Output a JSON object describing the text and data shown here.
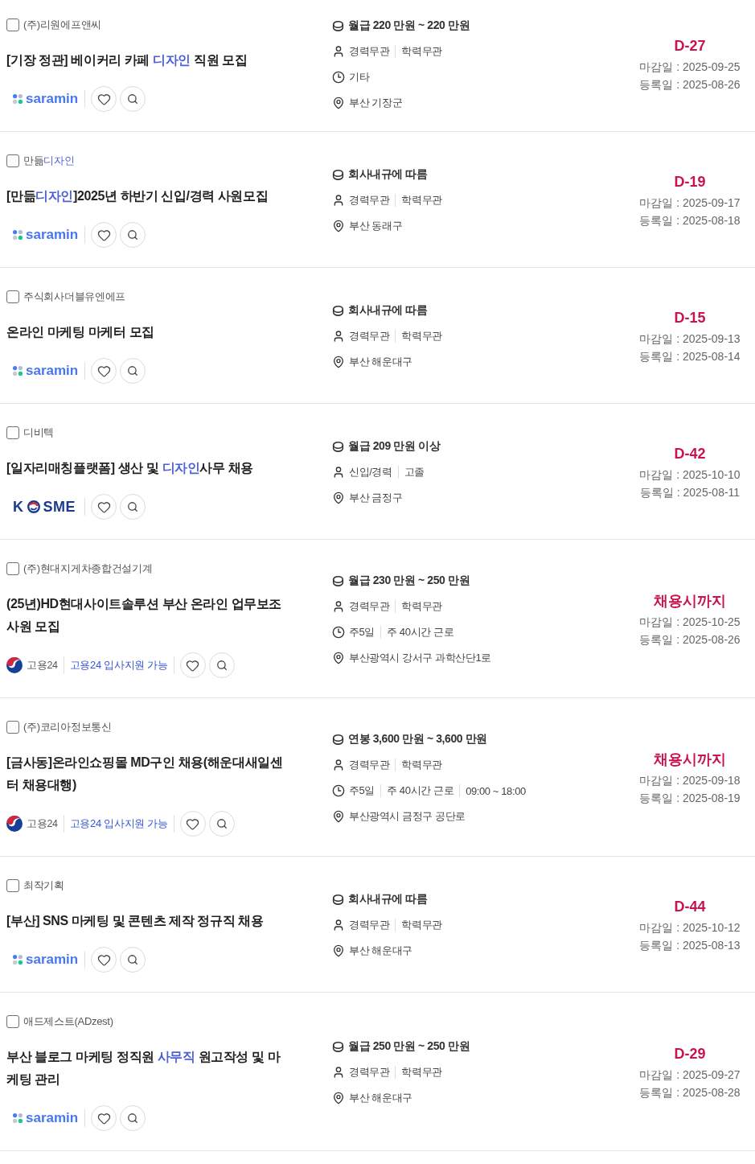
{
  "jobs": [
    {
      "checked": false,
      "company": [
        {
          "text": "(주)리원에프앤씨",
          "highlight": false
        }
      ],
      "title": [
        {
          "text": "[기장 정관] 베이커리 카페 ",
          "highlight": false
        },
        {
          "text": "디자인",
          "highlight": true
        },
        {
          "text": " 직원 모집",
          "highlight": false
        }
      ],
      "source": {
        "kind": "dots",
        "wordmark": [
          "saramin"
        ]
      },
      "saved": false,
      "details": [
        {
          "kind": "salary",
          "values": [
            "월급 220 만원 ~ 220 만원"
          ]
        },
        {
          "kind": "career",
          "values": [
            "경력무관",
            "학력무관"
          ]
        },
        {
          "kind": "time",
          "values": [
            "기타"
          ]
        },
        {
          "kind": "location",
          "values": [
            "부산 기장군"
          ]
        }
      ],
      "deadline": "D-27",
      "deadline_date": "마감일 : 2025-09-25",
      "posted_date": "등록일 : 2025-08-26"
    },
    {
      "checked": false,
      "company": [
        {
          "text": "만듦",
          "highlight": false
        },
        {
          "text": "디자인",
          "highlight": true
        }
      ],
      "title": [
        {
          "text": "[만듦",
          "highlight": false
        },
        {
          "text": "디자인",
          "highlight": true
        },
        {
          "text": "]2025년 하반기 신입/경력 사원모집",
          "highlight": false
        }
      ],
      "source": {
        "kind": "dots",
        "wordmark": [
          "saramin"
        ]
      },
      "saved": false,
      "details": [
        {
          "kind": "salary",
          "values": [
            "회사내규에 따름"
          ]
        },
        {
          "kind": "career",
          "values": [
            "경력무관",
            "학력무관"
          ]
        },
        {
          "kind": "location",
          "values": [
            "부산 동래구"
          ]
        }
      ],
      "deadline": "D-19",
      "deadline_date": "마감일 : 2025-09-17",
      "posted_date": "등록일 : 2025-08-18"
    },
    {
      "checked": false,
      "company": [
        {
          "text": "주식회사더블유엔에프",
          "highlight": false
        }
      ],
      "title": [
        {
          "text": "온라인 마케팅 마케터 모집",
          "highlight": false
        }
      ],
      "source": {
        "kind": "dots",
        "wordmark": [
          "saramin"
        ]
      },
      "saved": false,
      "details": [
        {
          "kind": "salary",
          "values": [
            "회사내규에 따름"
          ]
        },
        {
          "kind": "career",
          "values": [
            "경력무관",
            "학력무관"
          ]
        },
        {
          "kind": "location",
          "values": [
            "부산 해운대구"
          ]
        }
      ],
      "deadline": "D-15",
      "deadline_date": "마감일 : 2025-09-13",
      "posted_date": "등록일 : 2025-08-14"
    },
    {
      "checked": false,
      "company": [
        {
          "text": "디비텍",
          "highlight": false
        }
      ],
      "title": [
        {
          "text": "[일자리매칭플랫폼] 생산 및 ",
          "highlight": false
        },
        {
          "text": "디자인",
          "highlight": true
        },
        {
          "text": "사무 채용",
          "highlight": false
        }
      ],
      "source": {
        "kind": "swirl",
        "wordmark": [
          "K",
          "SME"
        ]
      },
      "saved": false,
      "details": [
        {
          "kind": "salary",
          "values": [
            "월급 209 만원 이상"
          ]
        },
        {
          "kind": "career",
          "values": [
            "신입/경력",
            "고졸"
          ]
        },
        {
          "kind": "location",
          "values": [
            "부산 금정구"
          ]
        }
      ],
      "deadline": "D-42",
      "deadline_date": "마감일 : 2025-10-10",
      "posted_date": "등록일 : 2025-08-11"
    },
    {
      "checked": false,
      "company": [
        {
          "text": "(주)현대지게차종합건설기계",
          "highlight": false
        }
      ],
      "title": [
        {
          "text": "(25년)HD현대사이트솔루션 부산 온라인 업무보조 사원 모집",
          "highlight": false
        }
      ],
      "source": {
        "kind": "emblem",
        "wordmark": [
          "고용24"
        ],
        "apply_link": "고용24 입사지원 가능"
      },
      "saved": false,
      "details": [
        {
          "kind": "salary",
          "values": [
            "월급 230 만원 ~ 250 만원"
          ]
        },
        {
          "kind": "career",
          "values": [
            "경력무관",
            "학력무관"
          ]
        },
        {
          "kind": "time",
          "values": [
            "주5일",
            "주 40시간 근로"
          ]
        },
        {
          "kind": "location",
          "values": [
            "부산광역시 강서구 과학산단1로"
          ]
        }
      ],
      "deadline": "채용시까지",
      "deadline_date": "마감일 : 2025-10-25",
      "posted_date": "등록일 : 2025-08-26"
    },
    {
      "checked": false,
      "company": [
        {
          "text": "(주)코리아정보통신",
          "highlight": false
        }
      ],
      "title": [
        {
          "text": "[금사동]온라인쇼핑몰 MD구인 채용(해운대새일센터 채용대행)",
          "highlight": false
        }
      ],
      "source": {
        "kind": "emblem",
        "wordmark": [
          "고용24"
        ],
        "apply_link": "고용24 입사지원 가능"
      },
      "saved": false,
      "details": [
        {
          "kind": "salary",
          "values": [
            "연봉 3,600 만원 ~ 3,600 만원"
          ]
        },
        {
          "kind": "career",
          "values": [
            "경력무관",
            "학력무관"
          ]
        },
        {
          "kind": "time",
          "values": [
            "주5일",
            "주 40시간 근로",
            "09:00 ~ 18:00"
          ]
        },
        {
          "kind": "location",
          "values": [
            "부산광역시 금정구 공단로"
          ]
        }
      ],
      "deadline": "채용시까지",
      "deadline_date": "마감일 : 2025-09-18",
      "posted_date": "등록일 : 2025-08-19"
    },
    {
      "checked": false,
      "company": [
        {
          "text": "최작기획",
          "highlight": false
        }
      ],
      "title": [
        {
          "text": "[부산] SNS 마케팅 및 콘텐츠 제작 정규직 채용",
          "highlight": false
        }
      ],
      "source": {
        "kind": "dots",
        "wordmark": [
          "saramin"
        ]
      },
      "saved": false,
      "details": [
        {
          "kind": "salary",
          "values": [
            "회사내규에 따름"
          ]
        },
        {
          "kind": "career",
          "values": [
            "경력무관",
            "학력무관"
          ]
        },
        {
          "kind": "location",
          "values": [
            "부산 해운대구"
          ]
        }
      ],
      "deadline": "D-44",
      "deadline_date": "마감일 : 2025-10-12",
      "posted_date": "등록일 : 2025-08-13"
    },
    {
      "checked": false,
      "company": [
        {
          "text": "애드제스트(ADzest)",
          "highlight": false
        }
      ],
      "title": [
        {
          "text": "부산 블로그 마케팅 정직원 ",
          "highlight": false
        },
        {
          "text": "사무직",
          "highlight": true
        },
        {
          "text": " 원고작성 및 마케팅 관리",
          "highlight": false
        }
      ],
      "source": {
        "kind": "dots",
        "wordmark": [
          "saramin"
        ]
      },
      "saved": false,
      "details": [
        {
          "kind": "salary",
          "values": [
            "월급 250 만원 ~ 250 만원"
          ]
        },
        {
          "kind": "career",
          "values": [
            "경력무관",
            "학력무관"
          ]
        },
        {
          "kind": "location",
          "values": [
            "부산 해운대구"
          ]
        }
      ],
      "deadline": "D-29",
      "deadline_date": "마감일 : 2025-09-27",
      "posted_date": "등록일 : 2025-08-28"
    }
  ]
}
